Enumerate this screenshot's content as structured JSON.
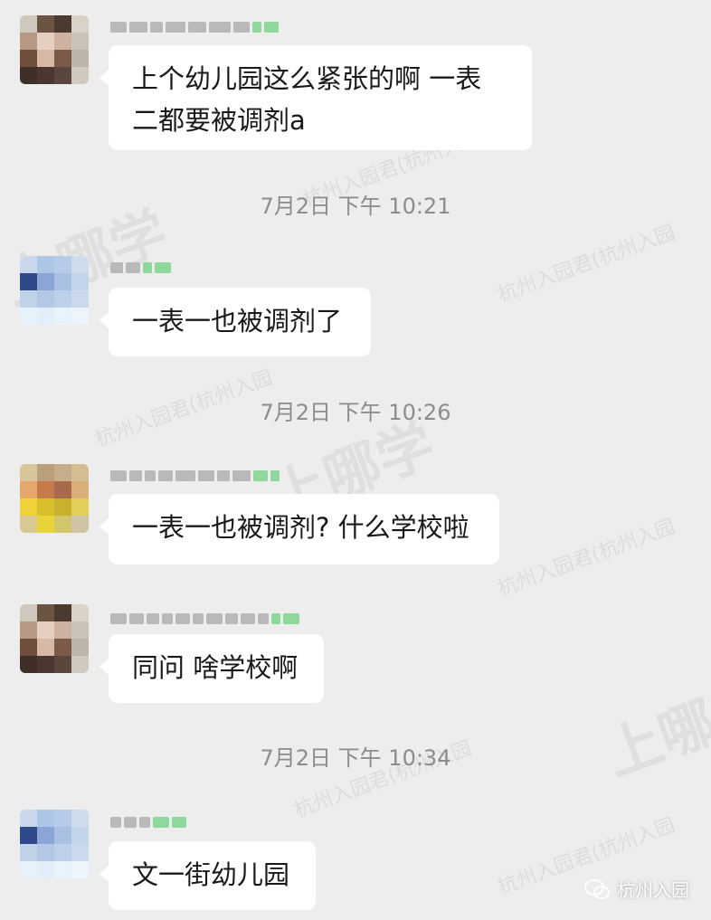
{
  "watermark": {
    "small_text": "杭州入园君(杭州入园",
    "big_text": "上哪学"
  },
  "messages": [
    {
      "avatar_colors": [
        "#cfc8bd",
        "#6b5442",
        "#4b3a30",
        "#d9d2c7",
        "#b79a86",
        "#e5cfc0",
        "#cdb2a2",
        "#c9c3b8",
        "#6f4e3e",
        "#d8b8a6",
        "#7b5a4a",
        "#bdb5aa",
        "#3e2f28",
        "#4a3830",
        "#5a463c",
        "#cfc9bf"
      ],
      "sender_blocks": [
        18,
        20,
        14,
        22,
        20,
        24,
        18,
        10,
        16
      ],
      "text": "上个幼儿园这么紧张的啊 一表\n二都要被调剂a"
    },
    {
      "time": "7月2日  下午 10:21"
    },
    {
      "avatar_colors": [
        "#c9d8ec",
        "#aec6e6",
        "#b6cbe8",
        "#cfdcee",
        "#2e4a8a",
        "#8aa6d6",
        "#a9c0e3",
        "#c4d4ea",
        "#c0d2e8",
        "#b4c8e5",
        "#bcd0e9",
        "#cad9ec",
        "#e7f1fb",
        "#e2eef9",
        "#e9f3fb",
        "#edf4fb"
      ],
      "sender_blocks": [
        14,
        16,
        10,
        18
      ],
      "text": "一表一也被调剂了"
    },
    {
      "time": "7月2日  下午 10:26"
    },
    {
      "avatar_colors": [
        "#d9c59a",
        "#b9a07a",
        "#c7ae8a",
        "#d4bd93",
        "#e6a86a",
        "#c77a4a",
        "#a86a4a",
        "#d9b07a",
        "#efd23a",
        "#d9c02a",
        "#c9b12f",
        "#e2cf5a",
        "#d7c894",
        "#e8d33a",
        "#d1c66a",
        "#cfc4a6"
      ],
      "sender_blocks": [
        18,
        14,
        12,
        16,
        22,
        18,
        14,
        20,
        16,
        10
      ],
      "text": "一表一也被调剂? 什么学校啦"
    },
    {
      "avatar_colors": [
        "#cfc8bd",
        "#6b5442",
        "#4b3a30",
        "#d9d2c7",
        "#b79a86",
        "#e5cfc0",
        "#cdb2a2",
        "#c9c3b8",
        "#6f4e3e",
        "#d8b8a6",
        "#7b5a4a",
        "#bdb5aa",
        "#3e2f28",
        "#4a3830",
        "#5a463c",
        "#cfc9bf"
      ],
      "sender_blocks": [
        18,
        16,
        14,
        12,
        16,
        12,
        18,
        14,
        16,
        12,
        10,
        18
      ],
      "text": "同问 啥学校啊"
    },
    {
      "time": "7月2日  下午 10:34"
    },
    {
      "avatar_colors": [
        "#c9d8ec",
        "#aec6e6",
        "#b6cbe8",
        "#cfdcee",
        "#2e4a8a",
        "#8aa6d6",
        "#a9c0e3",
        "#c4d4ea",
        "#c0d2e8",
        "#b4c8e5",
        "#bcd0e9",
        "#cad9ec",
        "#e7f1fb",
        "#e2eef9",
        "#e9f3fb",
        "#edf4fb"
      ],
      "sender_blocks": [
        12,
        14,
        12,
        18,
        16
      ],
      "text": "文一街幼儿园"
    }
  ],
  "footer": {
    "account_name": "杭州入园"
  }
}
